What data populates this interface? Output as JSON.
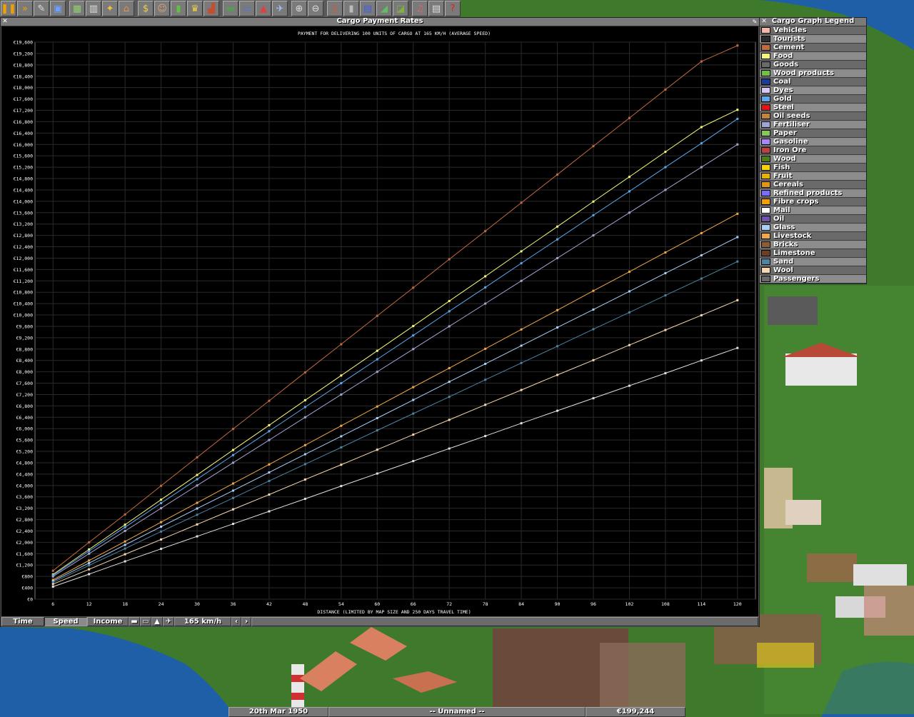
{
  "toolbar": {
    "buttons": [
      {
        "name": "pause-icon",
        "glyph": "❚❚",
        "color": "#f0a000"
      },
      {
        "name": "fast-forward-icon",
        "glyph": "»",
        "color": "#f0a000"
      },
      {
        "name": "settings-icon",
        "glyph": "✎",
        "color": "#ddd"
      },
      {
        "name": "save-icon",
        "glyph": "▣",
        "color": "#6fa0ff"
      },
      {
        "name": "gap"
      },
      {
        "name": "minimap-icon",
        "glyph": "▦",
        "color": "#8fd06a"
      },
      {
        "name": "town-directory-icon",
        "glyph": "▥",
        "color": "#ddd"
      },
      {
        "name": "subsidies-icon",
        "glyph": "✦",
        "color": "#f0c040"
      },
      {
        "name": "station-list-icon",
        "glyph": "⌂",
        "color": "#e09050"
      },
      {
        "name": "gap"
      },
      {
        "name": "finances-icon",
        "glyph": "$",
        "color": "#f0d040"
      },
      {
        "name": "company-icon",
        "glyph": "☺",
        "color": "#e0a070"
      },
      {
        "name": "graphs-icon",
        "glyph": "▮",
        "color": "#60c040"
      },
      {
        "name": "league-table-icon",
        "glyph": "♛",
        "color": "#f0d040"
      },
      {
        "name": "industry-icon",
        "glyph": "▟",
        "color": "#c05030"
      },
      {
        "name": "gap"
      },
      {
        "name": "trains-icon",
        "glyph": "▬",
        "color": "#50a050"
      },
      {
        "name": "road-vehicles-icon",
        "glyph": "▭",
        "color": "#5070e0"
      },
      {
        "name": "ships-icon",
        "glyph": "▲",
        "color": "#e04040"
      },
      {
        "name": "aircraft-icon",
        "glyph": "✈",
        "color": "#a0c0ff"
      },
      {
        "name": "gap"
      },
      {
        "name": "zoom-in-icon",
        "glyph": "⊕",
        "color": "#ddd"
      },
      {
        "name": "zoom-out-icon",
        "glyph": "⊖",
        "color": "#ddd"
      },
      {
        "name": "gap"
      },
      {
        "name": "build-rail-icon",
        "glyph": "‖",
        "color": "#c06040"
      },
      {
        "name": "build-road-icon",
        "glyph": "▮",
        "color": "#bbb"
      },
      {
        "name": "build-water-icon",
        "glyph": "▤",
        "color": "#4060e0"
      },
      {
        "name": "build-airport-icon",
        "glyph": "◢",
        "color": "#60c060"
      },
      {
        "name": "landscaping-icon",
        "glyph": "◪",
        "color": "#80b040"
      },
      {
        "name": "gap"
      },
      {
        "name": "music-icon",
        "glyph": "♫",
        "color": "#e06060"
      },
      {
        "name": "news-icon",
        "glyph": "▤",
        "color": "#ddd"
      },
      {
        "name": "help-icon",
        "glyph": "?",
        "color": "#e02020"
      }
    ]
  },
  "graph_window": {
    "title": "Cargo Payment Rates",
    "close_glyph": "✕",
    "pin_glyph": "✎",
    "tabs": {
      "time": "Time",
      "speed": "Speed",
      "income": "Income"
    },
    "speed_value": "165 km/h",
    "arrow_left": "‹",
    "arrow_right": "›",
    "vehicle_icons": [
      "train-icon",
      "road-vehicle-icon",
      "ship-icon",
      "aircraft-icon"
    ]
  },
  "legend_window": {
    "title": "Cargo Graph Legend",
    "close_glyph": "✕",
    "items": [
      {
        "label": "Vehicles",
        "color": "#f4b8a8"
      },
      {
        "label": "Tourists",
        "color": "#2c2c2c"
      },
      {
        "label": "Cement",
        "color": "#c46a40"
      },
      {
        "label": "Food",
        "color": "#f8f878"
      },
      {
        "label": "Goods",
        "color": "#6a6a6a"
      },
      {
        "label": "Wood products",
        "color": "#74c044"
      },
      {
        "label": "Coal",
        "color": "#1c3c9c"
      },
      {
        "label": "Dyes",
        "color": "#d8c8f8"
      },
      {
        "label": "Gold",
        "color": "#5ca8ec"
      },
      {
        "label": "Steel",
        "color": "#e41414"
      },
      {
        "label": "Oil seeds",
        "color": "#c4843c"
      },
      {
        "label": "Fertiliser",
        "color": "#a4a4d4"
      },
      {
        "label": "Paper",
        "color": "#88c858"
      },
      {
        "label": "Gasoline",
        "color": "#a888f8"
      },
      {
        "label": "Iron Ore",
        "color": "#c04040"
      },
      {
        "label": "Wood",
        "color": "#4c7c1c"
      },
      {
        "label": "Fish",
        "color": "#f8d400"
      },
      {
        "label": "Fruit",
        "color": "#e4b400"
      },
      {
        "label": "Cereals",
        "color": "#e89410"
      },
      {
        "label": "Refined products",
        "color": "#7c6cf8"
      },
      {
        "label": "Fibre crops",
        "color": "#f8a000"
      },
      {
        "label": "Mail",
        "color": "#ffffff"
      },
      {
        "label": "Oil",
        "color": "#7050b0"
      },
      {
        "label": "Glass",
        "color": "#a8d0f8"
      },
      {
        "label": "Livestock",
        "color": "#f0a848"
      },
      {
        "label": "Bricks",
        "color": "#8c5c34"
      },
      {
        "label": "Limestone",
        "color": "#6c4024"
      },
      {
        "label": "Sand",
        "color": "#4c84a4"
      },
      {
        "label": "Wool",
        "color": "#f8d8b0"
      },
      {
        "label": "Passengers",
        "color": "#6a6a6a"
      }
    ]
  },
  "statusbar": {
    "date": "20th Mar 1950",
    "company": "-- Unnamed --",
    "money": "€199,244"
  },
  "chart_data": {
    "type": "line",
    "title": "PAYMENT FOR DELIVERING 100 UNITS OF CARGO AT 165 KM/H (AVERAGE SPEED)",
    "xlabel": "DISTANCE (LIMITED BY MAP SIZE AND 250 DAYS TRAVEL TIME)",
    "ylabel": "",
    "x": [
      6,
      12,
      18,
      24,
      30,
      36,
      42,
      48,
      54,
      60,
      66,
      72,
      78,
      84,
      90,
      96,
      102,
      108,
      114,
      120
    ],
    "xlim": [
      3,
      123
    ],
    "ylim": [
      0,
      19600
    ],
    "ytick_step": 400,
    "grid": true,
    "currency_prefix": "€",
    "series": [
      {
        "color": "#c46a40",
        "values": [
          1000,
          2000,
          2980,
          3990,
          4990,
          5990,
          6980,
          7980,
          8970,
          9970,
          10960,
          11960,
          12950,
          13950,
          14940,
          15940,
          16930,
          17930,
          18920,
          19480
        ]
      },
      {
        "color": "#f8f878",
        "values": [
          870,
          1750,
          2620,
          3500,
          4370,
          5250,
          6120,
          7000,
          7870,
          8740,
          9610,
          10490,
          11360,
          12240,
          13110,
          13990,
          14860,
          15740,
          16610,
          17220
        ]
      },
      {
        "color": "#5ca8ec",
        "values": [
          840,
          1690,
          2530,
          3380,
          4220,
          5070,
          5910,
          6760,
          7600,
          8440,
          9280,
          10130,
          10970,
          11820,
          12660,
          13510,
          14350,
          15200,
          16040,
          16900
        ]
      },
      {
        "color": "#a4a4d4",
        "values": [
          800,
          1600,
          2400,
          3200,
          4000,
          4800,
          5600,
          6400,
          7200,
          8000,
          8800,
          9600,
          10400,
          11200,
          12000,
          12800,
          13600,
          14400,
          15200,
          16000
        ]
      },
      {
        "color": "#f0a848",
        "values": [
          680,
          1360,
          2030,
          2710,
          3390,
          4070,
          4740,
          5420,
          6100,
          6780,
          7460,
          8130,
          8810,
          9490,
          10170,
          10850,
          11520,
          12200,
          12880,
          13560
        ]
      },
      {
        "color": "#a8d0f8",
        "values": [
          640,
          1270,
          1910,
          2550,
          3190,
          3820,
          4460,
          5100,
          5730,
          6370,
          7010,
          7650,
          8280,
          8920,
          9560,
          10190,
          10830,
          11470,
          12100,
          12740
        ]
      },
      {
        "color": "#4c84a4",
        "values": [
          590,
          1190,
          1780,
          2380,
          2970,
          3560,
          4160,
          4750,
          5340,
          5940,
          6530,
          7120,
          7720,
          8310,
          8900,
          9500,
          10090,
          10690,
          11280,
          11880
        ]
      },
      {
        "color": "#f8d8b0",
        "values": [
          530,
          1050,
          1580,
          2100,
          2630,
          3160,
          3680,
          4210,
          4730,
          5260,
          5790,
          6310,
          6840,
          7360,
          7890,
          8410,
          8940,
          9470,
          9990,
          10520
        ]
      },
      {
        "color": "#e0e0e0",
        "values": [
          440,
          880,
          1330,
          1770,
          2210,
          2650,
          3090,
          3530,
          3980,
          4420,
          4860,
          5300,
          5740,
          6190,
          6630,
          7070,
          7510,
          7950,
          8400,
          8840
        ]
      }
    ]
  }
}
